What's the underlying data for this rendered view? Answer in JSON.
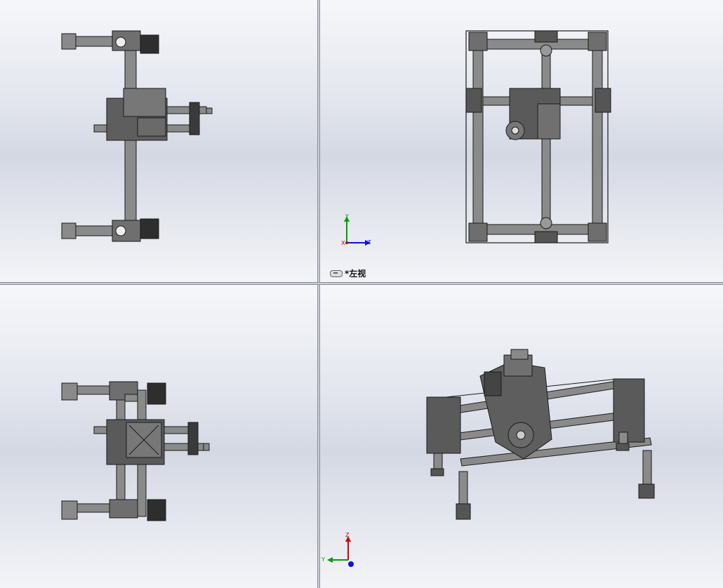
{
  "viewports": {
    "top_left": {
      "name": "top"
    },
    "top_right": {
      "label": "*左视",
      "triad": {
        "y": "Y",
        "z": "Z",
        "x": "X"
      }
    },
    "bottom_left": {
      "name": "front"
    },
    "bottom_right": {
      "triad": {
        "z": "Z",
        "y": "Y"
      }
    }
  },
  "colors": {
    "axis_x": "#d00000",
    "axis_y": "#00a000",
    "axis_z": "#1010e0",
    "model": "#808080",
    "model_edge": "#1a1a1a"
  }
}
